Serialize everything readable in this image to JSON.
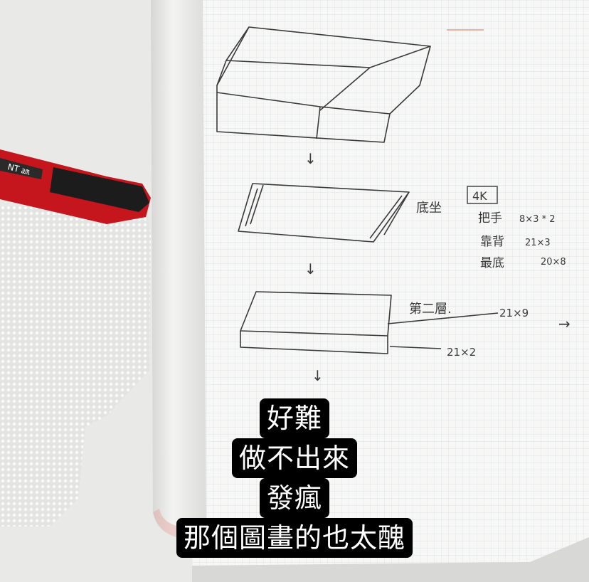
{
  "captions": [
    "好難",
    "做不出來",
    "發瘋",
    "那個圖畫的也太醜"
  ],
  "cutter_brand": "NT ㏂",
  "notes": {
    "box_4k": "4K",
    "label_base": "底坐",
    "handle": "把手",
    "handle_dims": "8×3 * 2",
    "backrest": "靠背",
    "backrest_dims": "21×3",
    "bottom": "最底",
    "bottom_dims": "20×8",
    "layer_two": "第二層.",
    "layer_two_dims": "21×9",
    "base_dims": "21×2",
    "arrow_right": "→",
    "arrow_down": "↓"
  },
  "colors": {
    "paper": "#f7f7f5",
    "grid": "#d9dde4",
    "table": "#e9e9e7",
    "cutter_red": "#c4161c",
    "caption_bg": "#000000",
    "caption_fg": "#ffffff"
  }
}
